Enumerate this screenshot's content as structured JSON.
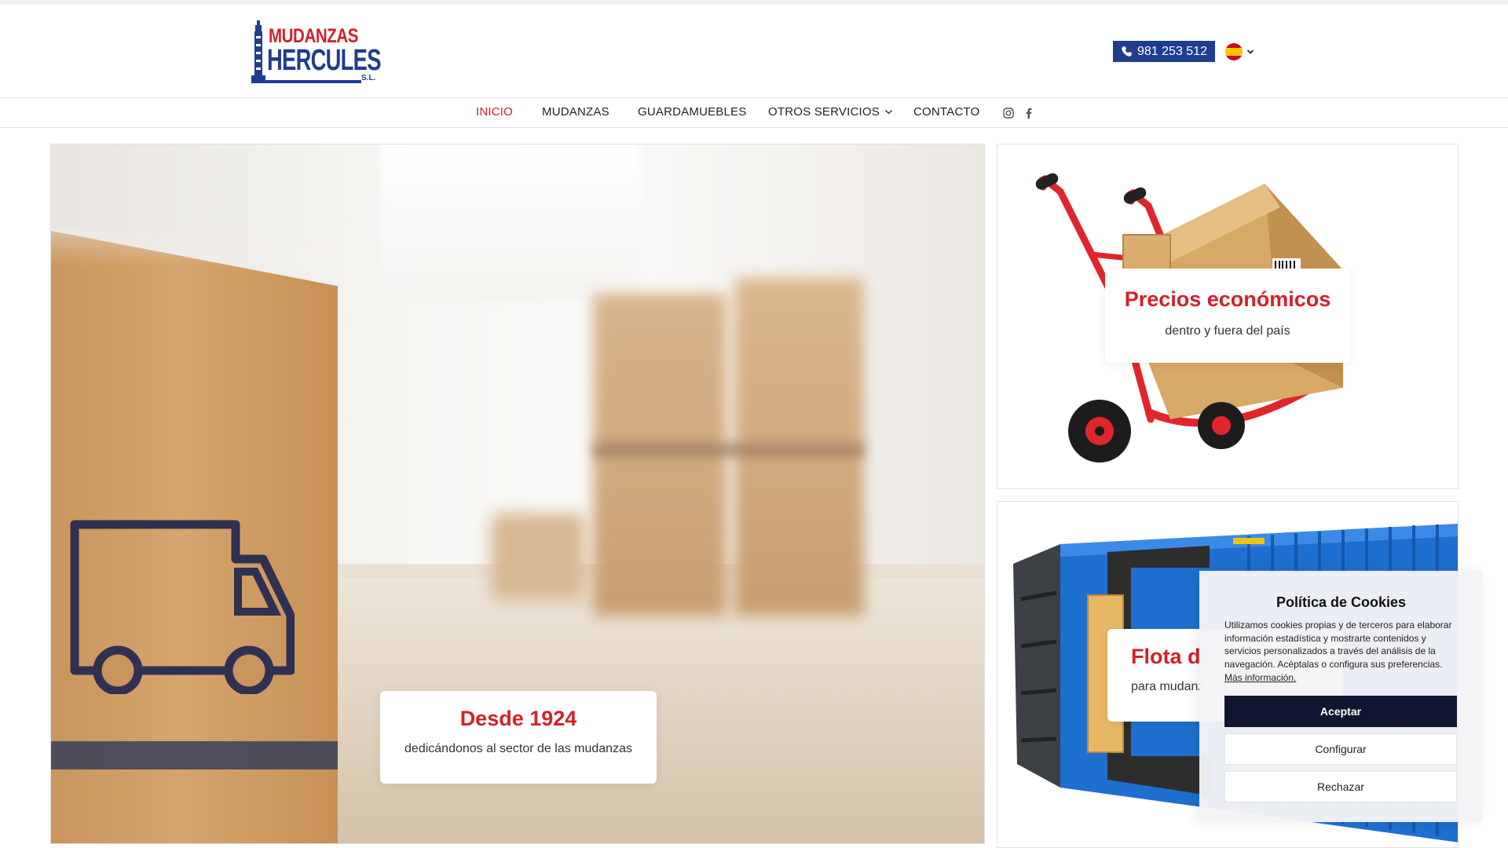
{
  "header": {
    "logo": {
      "line1": "MUDANZAS",
      "line2": "HERCULES",
      "line3": "S.L."
    },
    "phone": "981 253 512",
    "language": {
      "icon": "spain-flag-icon",
      "chevron": "chevron-down-icon"
    }
  },
  "nav": {
    "items": [
      {
        "label": "INICIO",
        "active": true
      },
      {
        "label": "MUDANZAS",
        "active": false
      },
      {
        "label": "GUARDAMUEBLES",
        "active": false
      },
      {
        "label": "OTROS SERVICIOS",
        "active": false,
        "dropdown": true
      },
      {
        "label": "CONTACTO",
        "active": false
      }
    ],
    "social": [
      "instagram-icon",
      "facebook-icon"
    ]
  },
  "hero": {
    "title": "Desde 1924",
    "subtitle": "dedicándonos al sector de las mudanzas"
  },
  "promos": [
    {
      "title": "Precios económicos",
      "subtitle": "dentro y fuera del país"
    },
    {
      "title": "Flota d",
      "subtitle": "para mudanz"
    }
  ],
  "cookies": {
    "title": "Política de Cookies",
    "text": "Utilizamos cookies propias y de terceros para elaborar información estadística y mostrarte contenidos y servicios personalizados a través del análisis de la navegación. Acéptalas o configura sus preferencias.",
    "link": "Más información.",
    "accept": "Aceptar",
    "configure": "Configurar",
    "reject": "Rechazar"
  },
  "colors": {
    "brand_red": "#d3202a",
    "brand_blue": "#1f3d8f",
    "cookie_primary": "#101530"
  }
}
